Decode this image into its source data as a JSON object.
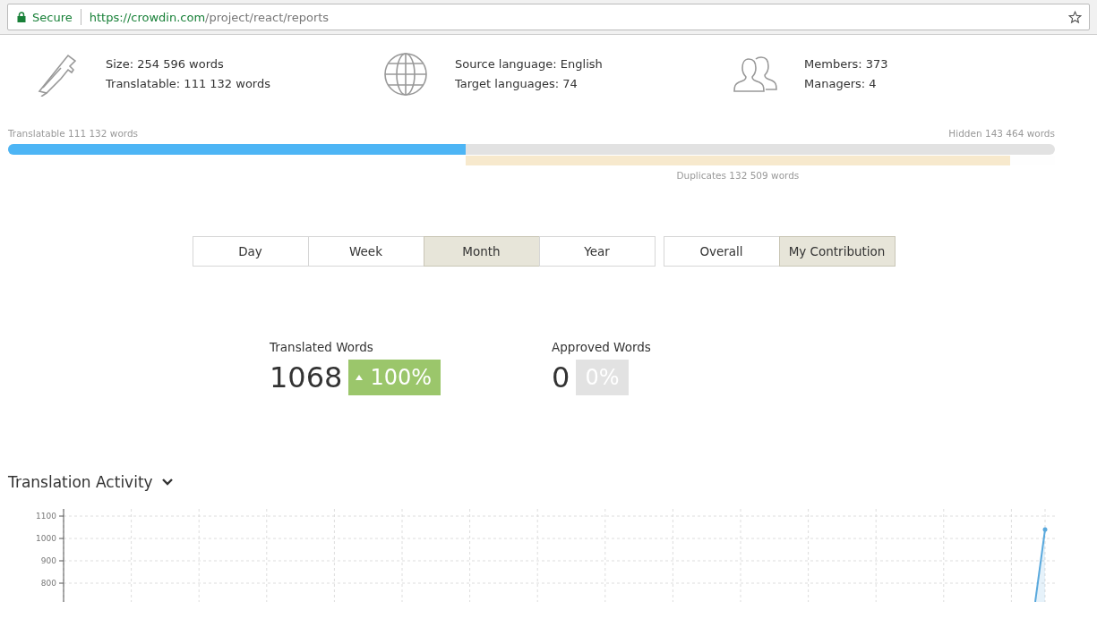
{
  "address_bar": {
    "security": "Secure",
    "url_host": "https://crowdin.com",
    "url_path": "/project/react/reports"
  },
  "stats": [
    {
      "kind": "size",
      "lines": [
        "Size: 254 596 words",
        "Translatable: 111 132 words"
      ]
    },
    {
      "kind": "language",
      "lines": [
        "Source language: English",
        "Target languages: 74"
      ]
    },
    {
      "kind": "members",
      "lines": [
        "Members: 373",
        "Managers: 4"
      ]
    }
  ],
  "words_bar": {
    "translatable": {
      "label": "Translatable 111 132 words",
      "level": 0.437
    },
    "hidden_label": "Hidden 143 464 words",
    "duplicates": {
      "label": "Duplicates 132 509 words",
      "level": 0.924
    }
  },
  "period_tabs": [
    {
      "label": "Day",
      "selected": false
    },
    {
      "label": "Week",
      "selected": false
    },
    {
      "label": "Month",
      "selected": true
    },
    {
      "label": "Year",
      "selected": false
    }
  ],
  "scope_tabs": [
    {
      "label": "Overall",
      "selected": false
    },
    {
      "label": "My Contribution",
      "selected": true
    }
  ],
  "metrics": [
    {
      "label": "Translated Words",
      "value": "1068",
      "change": "100%",
      "kind": "up"
    },
    {
      "label": "Approved Words",
      "value": "0",
      "change": "0%",
      "kind": "flat"
    }
  ],
  "activity": {
    "title": "Translation Activity",
    "y_tick_labels": [
      "1100",
      "1000",
      "900",
      "800"
    ]
  }
}
